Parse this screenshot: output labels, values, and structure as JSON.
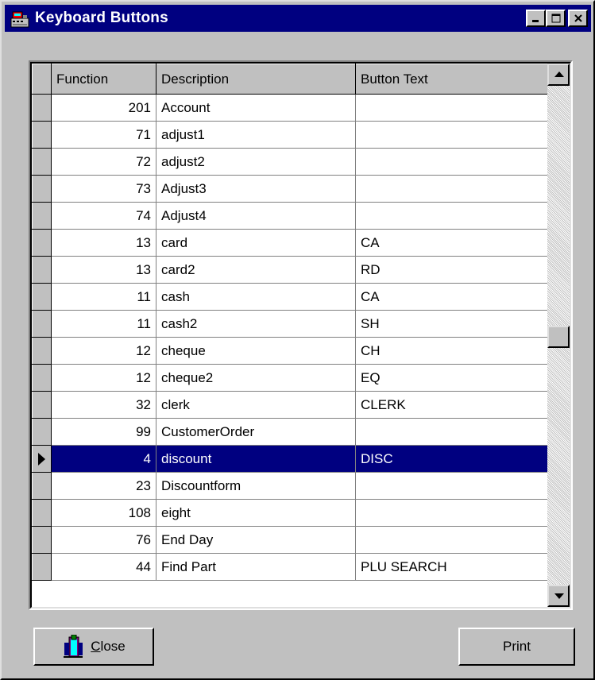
{
  "window": {
    "title": "Keyboard Buttons",
    "icon": "cash-register-icon"
  },
  "title_buttons": {
    "minimize": "_",
    "maximize": "□",
    "close": "×"
  },
  "grid": {
    "columns": [
      "Function",
      "Description",
      "Button Text"
    ],
    "rows": [
      {
        "function": "201",
        "description": "Account",
        "button_text": ""
      },
      {
        "function": "71",
        "description": "adjust1",
        "button_text": ""
      },
      {
        "function": "72",
        "description": "adjust2",
        "button_text": ""
      },
      {
        "function": "73",
        "description": "Adjust3",
        "button_text": ""
      },
      {
        "function": "74",
        "description": "Adjust4",
        "button_text": ""
      },
      {
        "function": "13",
        "description": "card",
        "button_text": "CA"
      },
      {
        "function": "13",
        "description": "card2",
        "button_text": "RD"
      },
      {
        "function": "11",
        "description": "cash",
        "button_text": "CA"
      },
      {
        "function": "11",
        "description": "cash2",
        "button_text": "SH"
      },
      {
        "function": "12",
        "description": "cheque",
        "button_text": "CH"
      },
      {
        "function": "12",
        "description": "cheque2",
        "button_text": "EQ"
      },
      {
        "function": "32",
        "description": "clerk",
        "button_text": "CLERK"
      },
      {
        "function": "99",
        "description": "CustomerOrder",
        "button_text": ""
      },
      {
        "function": "4",
        "description": "discount",
        "button_text": "DISC"
      },
      {
        "function": "23",
        "description": "Discountform",
        "button_text": ""
      },
      {
        "function": "108",
        "description": "eight",
        "button_text": ""
      },
      {
        "function": "76",
        "description": "End Day",
        "button_text": ""
      },
      {
        "function": "44",
        "description": "Find Part",
        "button_text": "PLU SEARCH"
      }
    ],
    "selected_row": 13
  },
  "buttons": {
    "close_label": "Close",
    "close_icon": "door-exit-icon",
    "print_label": "Print"
  },
  "colors": {
    "title_bar": "#000080",
    "selection": "#000080",
    "face": "#c0c0c0"
  }
}
